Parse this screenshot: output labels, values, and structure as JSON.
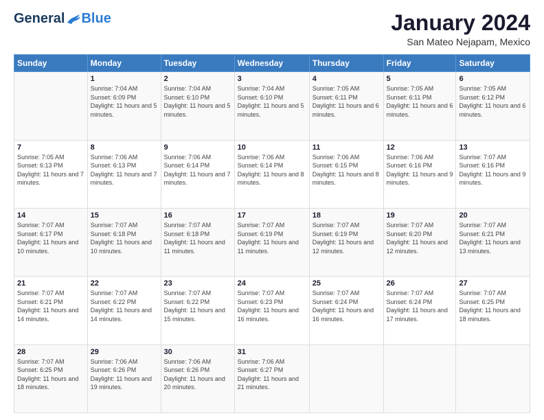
{
  "header": {
    "logo": {
      "general": "General",
      "blue": "Blue"
    },
    "title": "January 2024",
    "location": "San Mateo Nejapam, Mexico"
  },
  "weekdays": [
    "Sunday",
    "Monday",
    "Tuesday",
    "Wednesday",
    "Thursday",
    "Friday",
    "Saturday"
  ],
  "weeks": [
    [
      {
        "day": "",
        "sunrise": "",
        "sunset": "",
        "daylight": ""
      },
      {
        "day": "1",
        "sunrise": "Sunrise: 7:04 AM",
        "sunset": "Sunset: 6:09 PM",
        "daylight": "Daylight: 11 hours and 5 minutes."
      },
      {
        "day": "2",
        "sunrise": "Sunrise: 7:04 AM",
        "sunset": "Sunset: 6:10 PM",
        "daylight": "Daylight: 11 hours and 5 minutes."
      },
      {
        "day": "3",
        "sunrise": "Sunrise: 7:04 AM",
        "sunset": "Sunset: 6:10 PM",
        "daylight": "Daylight: 11 hours and 5 minutes."
      },
      {
        "day": "4",
        "sunrise": "Sunrise: 7:05 AM",
        "sunset": "Sunset: 6:11 PM",
        "daylight": "Daylight: 11 hours and 6 minutes."
      },
      {
        "day": "5",
        "sunrise": "Sunrise: 7:05 AM",
        "sunset": "Sunset: 6:11 PM",
        "daylight": "Daylight: 11 hours and 6 minutes."
      },
      {
        "day": "6",
        "sunrise": "Sunrise: 7:05 AM",
        "sunset": "Sunset: 6:12 PM",
        "daylight": "Daylight: 11 hours and 6 minutes."
      }
    ],
    [
      {
        "day": "7",
        "sunrise": "Sunrise: 7:05 AM",
        "sunset": "Sunset: 6:13 PM",
        "daylight": "Daylight: 11 hours and 7 minutes."
      },
      {
        "day": "8",
        "sunrise": "Sunrise: 7:06 AM",
        "sunset": "Sunset: 6:13 PM",
        "daylight": "Daylight: 11 hours and 7 minutes."
      },
      {
        "day": "9",
        "sunrise": "Sunrise: 7:06 AM",
        "sunset": "Sunset: 6:14 PM",
        "daylight": "Daylight: 11 hours and 7 minutes."
      },
      {
        "day": "10",
        "sunrise": "Sunrise: 7:06 AM",
        "sunset": "Sunset: 6:14 PM",
        "daylight": "Daylight: 11 hours and 8 minutes."
      },
      {
        "day": "11",
        "sunrise": "Sunrise: 7:06 AM",
        "sunset": "Sunset: 6:15 PM",
        "daylight": "Daylight: 11 hours and 8 minutes."
      },
      {
        "day": "12",
        "sunrise": "Sunrise: 7:06 AM",
        "sunset": "Sunset: 6:16 PM",
        "daylight": "Daylight: 11 hours and 9 minutes."
      },
      {
        "day": "13",
        "sunrise": "Sunrise: 7:07 AM",
        "sunset": "Sunset: 6:16 PM",
        "daylight": "Daylight: 11 hours and 9 minutes."
      }
    ],
    [
      {
        "day": "14",
        "sunrise": "Sunrise: 7:07 AM",
        "sunset": "Sunset: 6:17 PM",
        "daylight": "Daylight: 11 hours and 10 minutes."
      },
      {
        "day": "15",
        "sunrise": "Sunrise: 7:07 AM",
        "sunset": "Sunset: 6:18 PM",
        "daylight": "Daylight: 11 hours and 10 minutes."
      },
      {
        "day": "16",
        "sunrise": "Sunrise: 7:07 AM",
        "sunset": "Sunset: 6:18 PM",
        "daylight": "Daylight: 11 hours and 11 minutes."
      },
      {
        "day": "17",
        "sunrise": "Sunrise: 7:07 AM",
        "sunset": "Sunset: 6:19 PM",
        "daylight": "Daylight: 11 hours and 11 minutes."
      },
      {
        "day": "18",
        "sunrise": "Sunrise: 7:07 AM",
        "sunset": "Sunset: 6:19 PM",
        "daylight": "Daylight: 11 hours and 12 minutes."
      },
      {
        "day": "19",
        "sunrise": "Sunrise: 7:07 AM",
        "sunset": "Sunset: 6:20 PM",
        "daylight": "Daylight: 11 hours and 12 minutes."
      },
      {
        "day": "20",
        "sunrise": "Sunrise: 7:07 AM",
        "sunset": "Sunset: 6:21 PM",
        "daylight": "Daylight: 11 hours and 13 minutes."
      }
    ],
    [
      {
        "day": "21",
        "sunrise": "Sunrise: 7:07 AM",
        "sunset": "Sunset: 6:21 PM",
        "daylight": "Daylight: 11 hours and 14 minutes."
      },
      {
        "day": "22",
        "sunrise": "Sunrise: 7:07 AM",
        "sunset": "Sunset: 6:22 PM",
        "daylight": "Daylight: 11 hours and 14 minutes."
      },
      {
        "day": "23",
        "sunrise": "Sunrise: 7:07 AM",
        "sunset": "Sunset: 6:22 PM",
        "daylight": "Daylight: 11 hours and 15 minutes."
      },
      {
        "day": "24",
        "sunrise": "Sunrise: 7:07 AM",
        "sunset": "Sunset: 6:23 PM",
        "daylight": "Daylight: 11 hours and 16 minutes."
      },
      {
        "day": "25",
        "sunrise": "Sunrise: 7:07 AM",
        "sunset": "Sunset: 6:24 PM",
        "daylight": "Daylight: 11 hours and 16 minutes."
      },
      {
        "day": "26",
        "sunrise": "Sunrise: 7:07 AM",
        "sunset": "Sunset: 6:24 PM",
        "daylight": "Daylight: 11 hours and 17 minutes."
      },
      {
        "day": "27",
        "sunrise": "Sunrise: 7:07 AM",
        "sunset": "Sunset: 6:25 PM",
        "daylight": "Daylight: 11 hours and 18 minutes."
      }
    ],
    [
      {
        "day": "28",
        "sunrise": "Sunrise: 7:07 AM",
        "sunset": "Sunset: 6:25 PM",
        "daylight": "Daylight: 11 hours and 18 minutes."
      },
      {
        "day": "29",
        "sunrise": "Sunrise: 7:06 AM",
        "sunset": "Sunset: 6:26 PM",
        "daylight": "Daylight: 11 hours and 19 minutes."
      },
      {
        "day": "30",
        "sunrise": "Sunrise: 7:06 AM",
        "sunset": "Sunset: 6:26 PM",
        "daylight": "Daylight: 11 hours and 20 minutes."
      },
      {
        "day": "31",
        "sunrise": "Sunrise: 7:06 AM",
        "sunset": "Sunset: 6:27 PM",
        "daylight": "Daylight: 11 hours and 21 minutes."
      },
      {
        "day": "",
        "sunrise": "",
        "sunset": "",
        "daylight": ""
      },
      {
        "day": "",
        "sunrise": "",
        "sunset": "",
        "daylight": ""
      },
      {
        "day": "",
        "sunrise": "",
        "sunset": "",
        "daylight": ""
      }
    ]
  ]
}
